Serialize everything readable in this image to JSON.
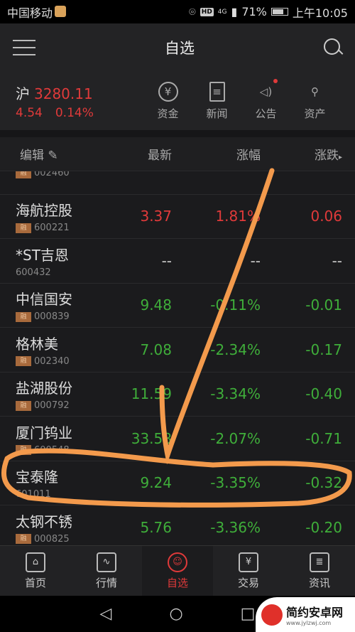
{
  "status_bar": {
    "carrier": "中国移动",
    "signal": "4G",
    "battery": "71%",
    "time": "上午10:05"
  },
  "header": {
    "title": "自选"
  },
  "index": {
    "name": "沪",
    "value": "3280.11",
    "change": "4.54",
    "change_pct": "0.14%"
  },
  "quick_links": [
    {
      "label": "资金",
      "icon": "yuan-circle-icon"
    },
    {
      "label": "新闻",
      "icon": "news-icon"
    },
    {
      "label": "公告",
      "icon": "speaker-icon"
    },
    {
      "label": "资产",
      "icon": "user-assets-icon"
    }
  ],
  "columns": {
    "edit": "编辑",
    "latest": "最新",
    "change_pct": "涨幅",
    "change": "涨跌"
  },
  "stocks": [
    {
      "name": "",
      "code": "002460",
      "rong": "融",
      "price": "",
      "pct": "",
      "chg": "",
      "trend": "down"
    },
    {
      "name": "海航控股",
      "code": "600221",
      "rong": "融",
      "price": "3.37",
      "pct": "1.81%",
      "chg": "0.06",
      "trend": "up"
    },
    {
      "name": "*ST吉恩",
      "code": "600432",
      "rong": "",
      "price": "--",
      "pct": "--",
      "chg": "--",
      "trend": "flat"
    },
    {
      "name": "中信国安",
      "code": "000839",
      "rong": "融",
      "price": "9.48",
      "pct": "-0.11%",
      "chg": "-0.01",
      "trend": "down"
    },
    {
      "name": "格林美",
      "code": "002340",
      "rong": "融",
      "price": "7.08",
      "pct": "-2.34%",
      "chg": "-0.17",
      "trend": "down"
    },
    {
      "name": "盐湖股份",
      "code": "000792",
      "rong": "融",
      "price": "11.59",
      "pct": "-3.34%",
      "chg": "-0.40",
      "trend": "down"
    },
    {
      "name": "厦门钨业",
      "code": "600548",
      "rong": "融",
      "price": "33.58",
      "pct": "-2.07%",
      "chg": "-0.71",
      "trend": "down"
    },
    {
      "name": "宝泰隆",
      "code": "601011",
      "rong": "",
      "price": "9.24",
      "pct": "-3.35%",
      "chg": "-0.32",
      "trend": "down"
    },
    {
      "name": "太钢不锈",
      "code": "000825",
      "rong": "融",
      "price": "5.76",
      "pct": "-3.36%",
      "chg": "-0.20",
      "trend": "down"
    }
  ],
  "tabs": [
    {
      "label": "首页",
      "icon": "home-icon"
    },
    {
      "label": "行情",
      "icon": "chart-icon"
    },
    {
      "label": "自选",
      "icon": "watchlist-icon",
      "active": true
    },
    {
      "label": "交易",
      "icon": "trade-icon"
    },
    {
      "label": "资讯",
      "icon": "info-icon"
    }
  ],
  "watermark": {
    "text": "简约安卓网",
    "url": "www.jylzwj.com"
  },
  "colors": {
    "up": "#e03a3a",
    "down": "#3fae3a",
    "annotation": "#f39a4c"
  }
}
